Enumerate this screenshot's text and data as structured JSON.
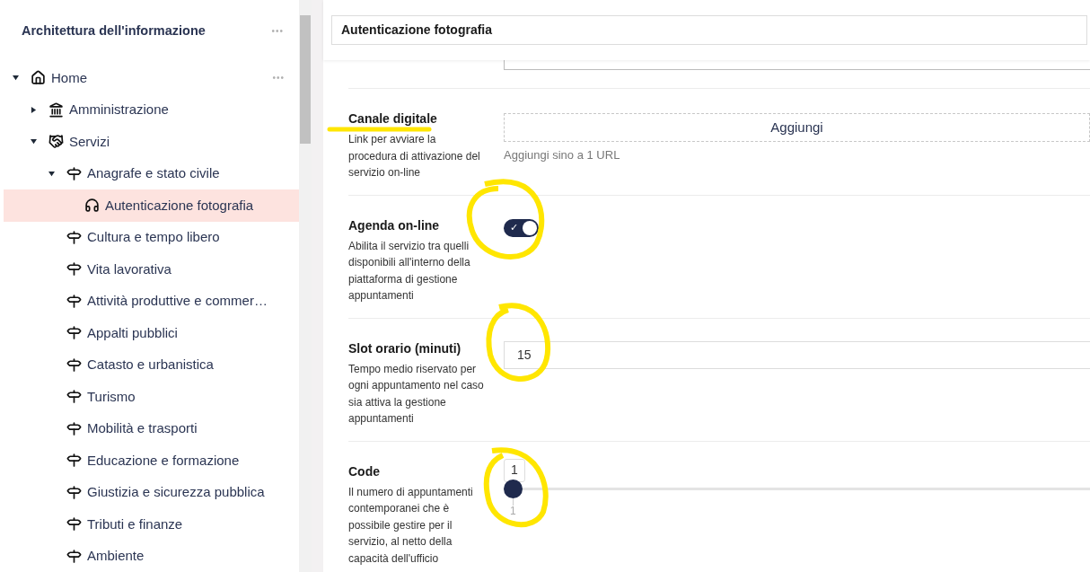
{
  "sidebar": {
    "title": "Architettura dell'informazione",
    "more": "•••",
    "tree": [
      {
        "label": "Home",
        "kind": "home",
        "expanded": true,
        "selected": false,
        "more": "•••",
        "children": [
          {
            "label": "Amministrazione",
            "kind": "bank",
            "expanded": false,
            "selected": false
          },
          {
            "label": "Servizi",
            "kind": "handshake",
            "expanded": true,
            "selected": false,
            "children": [
              {
                "label": "Anagrafe e stato civile",
                "kind": "signpost",
                "expanded": true,
                "selected": false,
                "children": [
                  {
                    "label": "Autenticazione fotografia",
                    "kind": "headset",
                    "selected": true
                  }
                ]
              },
              {
                "label": "Cultura e tempo libero",
                "kind": "signpost",
                "selected": false
              },
              {
                "label": "Vita lavorativa",
                "kind": "signpost",
                "selected": false
              },
              {
                "label": "Attività produttive e commer…",
                "kind": "signpost",
                "selected": false
              },
              {
                "label": "Appalti pubblici",
                "kind": "signpost",
                "selected": false
              },
              {
                "label": "Catasto e urbanistica",
                "kind": "signpost",
                "selected": false
              },
              {
                "label": "Turismo",
                "kind": "signpost",
                "selected": false
              },
              {
                "label": "Mobilità e trasporti",
                "kind": "signpost",
                "selected": false
              },
              {
                "label": "Educazione e formazione",
                "kind": "signpost",
                "selected": false
              },
              {
                "label": "Giustizia e sicurezza pubblica",
                "kind": "signpost",
                "selected": false
              },
              {
                "label": "Tributi e finanze",
                "kind": "signpost",
                "selected": false
              },
              {
                "label": "Ambiente",
                "kind": "signpost",
                "selected": false
              }
            ]
          }
        ]
      }
    ]
  },
  "header": {
    "title": "Autenticazione fotografia"
  },
  "fields": [
    {
      "kind": "url",
      "label": "Canale digitale",
      "description": "Link per avviare la procedura di attivazione del servizio on-line",
      "button": "Aggiungi",
      "hint": "Aggiungi sino a 1 URL"
    },
    {
      "kind": "toggle",
      "label": "Agenda on-line",
      "description": "Abilita il servizio tra quelli disponibili all'interno della piattaforma di gestione appuntamenti",
      "on": true,
      "check": "✓"
    },
    {
      "kind": "number",
      "label": "Slot orario (minuti)",
      "description": "Tempo medio riservato per ogni appuntamento nel caso sia attiva la gestione appuntamenti",
      "value": "15"
    },
    {
      "kind": "slider",
      "label": "Code",
      "description": "Il numero di appuntamenti contemporanei che è possibile gestire per il servizio, al netto della capacità dell'ufficio",
      "value": "1",
      "level": 0,
      "tick": "1"
    }
  ]
}
